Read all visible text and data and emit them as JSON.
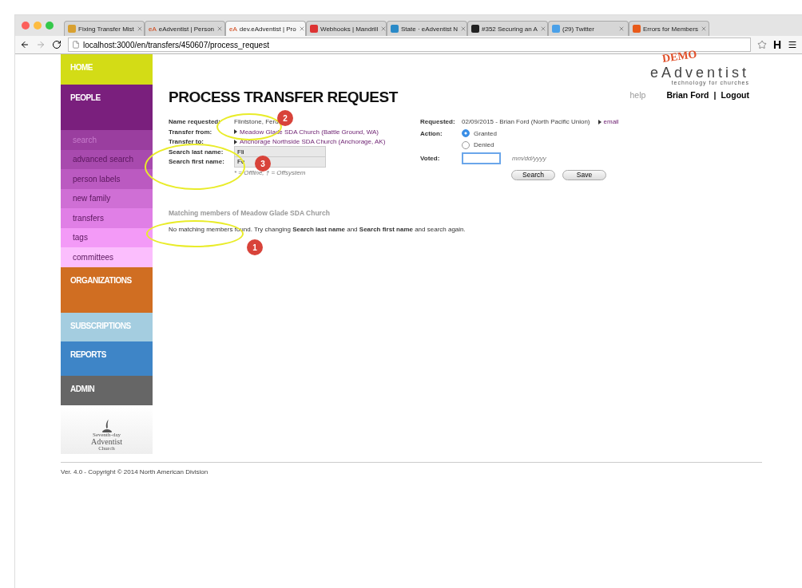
{
  "browser": {
    "tabs": [
      {
        "color": "#d8a030",
        "title": "Fixing Transfer Mist",
        "selected": false
      },
      {
        "icon_text": "eA",
        "title": "eAdventist | Person",
        "selected": false
      },
      {
        "icon_text": "eA",
        "title": "dev.eAdventist | Pro",
        "selected": true
      },
      {
        "color": "#dd3333",
        "title": "Webhooks | Mandrill",
        "selected": false
      },
      {
        "color": "#2a8ac8",
        "title": "State · eAdventist N",
        "selected": false
      },
      {
        "color": "#222222",
        "title": "#352 Securing an A",
        "selected": false
      },
      {
        "color": "#4aa0e8",
        "title": "(29) Twitter",
        "selected": false
      },
      {
        "color": "#e85a1a",
        "title": "Errors for Members",
        "selected": false
      }
    ],
    "url": "localhost:3000/en/transfers/450607/process_request",
    "toolbar_letter": "H"
  },
  "sidebar": {
    "sections": [
      {
        "label": "HOME",
        "color": "#d3dc16"
      },
      {
        "label": "PEOPLE",
        "color": "#7a1f7d",
        "children": [
          {
            "label": "search",
            "color": "#9a3e9f",
            "selected": true
          },
          {
            "label": "advanced search",
            "color": "#a84aae",
            "selected": false
          },
          {
            "label": "person labels",
            "color": "#bb5ac1",
            "selected": false
          },
          {
            "label": "new family",
            "color": "#cf6fd5",
            "selected": false
          },
          {
            "label": "transfers",
            "color": "#e07fe6",
            "selected": false
          },
          {
            "label": "tags",
            "color": "#f39af7",
            "selected": false
          },
          {
            "label": "committees",
            "color": "#fbbefd",
            "selected": false
          }
        ]
      },
      {
        "label": "ORGANIZATIONS",
        "color": "#d06e22"
      },
      {
        "label": "SUBSCRIPTIONS",
        "color": "#a4cde0"
      },
      {
        "label": "REPORTS",
        "color": "#3e85c7"
      },
      {
        "label": "ADMIN",
        "color": "#666666"
      }
    ],
    "logo_lines": [
      "Seventh-day",
      "Adventist",
      "Church"
    ]
  },
  "header": {
    "logo": "eAdventist",
    "tagline": "technology for churches",
    "stamp": "DEMO",
    "help": "help",
    "user": "Brian Ford",
    "separator": "|",
    "logout": "Logout"
  },
  "title": "PROCESS TRANSFER REQUEST",
  "left_fields": [
    {
      "kind": "text",
      "label": "Name requested:",
      "value": "Flintstone, Ferd"
    },
    {
      "kind": "link",
      "label": "Transfer from:",
      "value": "Meadow Glade SDA Church (Battle Ground, WA)"
    },
    {
      "kind": "link",
      "label": "Transfer to:",
      "value": "Anchorage Northside SDA Church (Anchorage, AK)"
    },
    {
      "kind": "input",
      "label": "Search last name:",
      "value": "Fli"
    },
    {
      "kind": "input",
      "label": "Search first name:",
      "value": "Fe"
    }
  ],
  "legend": "* = Offline, † = Offsystem",
  "right_fields": {
    "requested_label": "Requested:",
    "requested": "02/09/2015 - Brian Ford (North Pacific Union)",
    "email": "email",
    "action_label": "Action:",
    "options": [
      {
        "label": "Granted",
        "selected": true
      },
      {
        "label": "Denied",
        "selected": false
      }
    ],
    "voted_label": "Voted:",
    "voted_placeholder": "mm/dd/yyyy",
    "buttons": [
      "Search",
      "Save"
    ]
  },
  "matching": {
    "heading": "Matching members of Meadow Glade SDA Church",
    "message": "No matching members found. Try changing **Search last name** and **Search first name** and search again."
  },
  "annotations": [
    "1",
    "2",
    "3"
  ],
  "footer": "Ver. 4.0 - Copyright © 2014 North American Division"
}
